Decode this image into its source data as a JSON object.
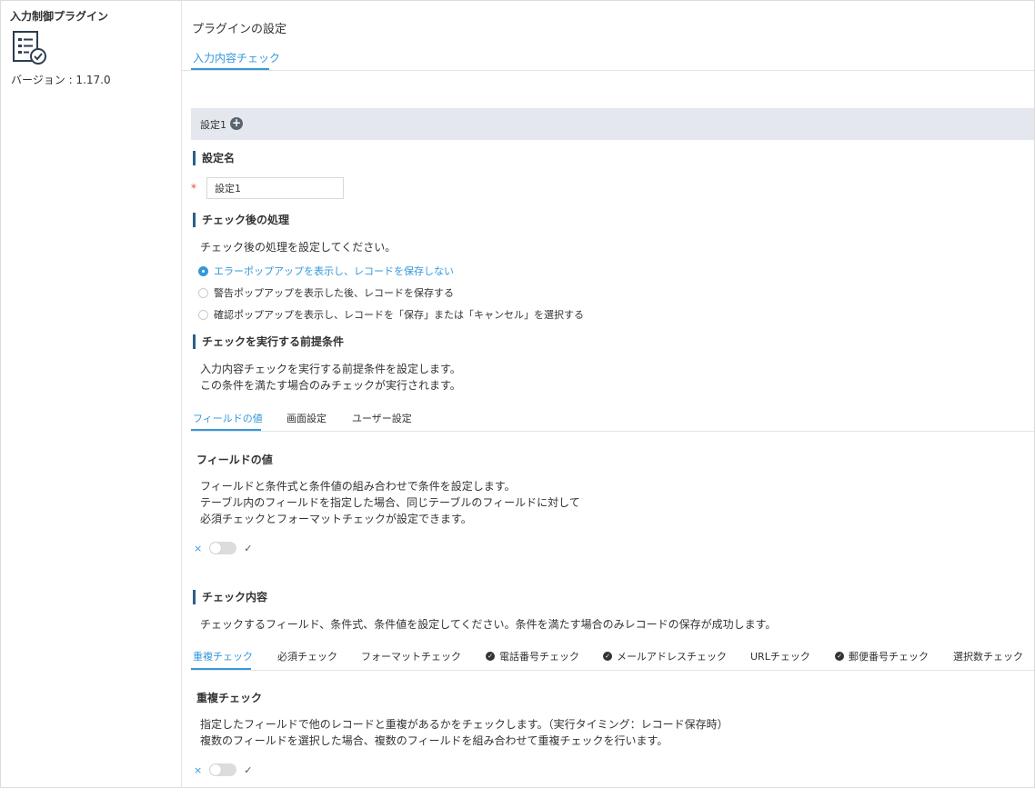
{
  "sidebar": {
    "plugin_name": "入力制御プラグイン",
    "icon": "form-check-icon",
    "version": "バージョン : 1.17.0"
  },
  "header": {
    "title": "プラグインの設定",
    "tab": "入力内容チェック"
  },
  "setting": {
    "label": "設定1",
    "add_icon": "+"
  },
  "setting_name": {
    "heading": "設定名",
    "required_mark": "*",
    "value": "設定1"
  },
  "after_check": {
    "heading": "チェック後の処理",
    "description": "チェック後の処理を設定してください。",
    "options": [
      "エラーポップアップを表示し、レコードを保存しない",
      "警告ポップアップを表示した後、レコードを保存する",
      "確認ポップアップを表示し、レコードを「保存」または「キャンセル」を選択する"
    ]
  },
  "precondition": {
    "heading": "チェックを実行する前提条件",
    "description_1": "入力内容チェックを実行する前提条件を設定します。",
    "description_2": "この条件を満たす場合のみチェックが実行されます。",
    "tabs": [
      "フィールドの値",
      "画面設定",
      "ユーザー設定"
    ],
    "panel_title": "フィールドの値",
    "panel_desc_1": "フィールドと条件式と条件値の組み合わせで条件を設定します。",
    "panel_desc_2": "テーブル内のフィールドを指定した場合、同じテーブルのフィールドに対して",
    "panel_desc_3": "必須チェックとフォーマットチェックが設定できます。",
    "toggle_off": "×",
    "toggle_on": "✓"
  },
  "check_content": {
    "heading": "チェック内容",
    "description": "チェックするフィールド、条件式、条件値を設定してください。条件を満たす場合のみレコードの保存が成功します。",
    "tabs": [
      "重複チェック",
      "必須チェック",
      "フォーマットチェック",
      "電話番号チェック",
      "メールアドレスチェック",
      "URLチェック",
      "郵便番号チェック",
      "選択数チェック"
    ],
    "panel_title": "重複チェック",
    "panel_desc_1": "指定したフィールドで他のレコードと重複があるかをチェックします。（実行タイミング：レコード保存時）",
    "panel_desc_2": "複数のフィールドを選択した場合、複数のフィールドを組み合わせて重複チェックを行います。",
    "toggle_off": "×",
    "toggle_on": "✓",
    "check_mark": "✓"
  },
  "colors": {
    "accent": "#3498db",
    "section_bar": "#2c5f8a",
    "setting_bar_bg": "#e4e8ee"
  }
}
